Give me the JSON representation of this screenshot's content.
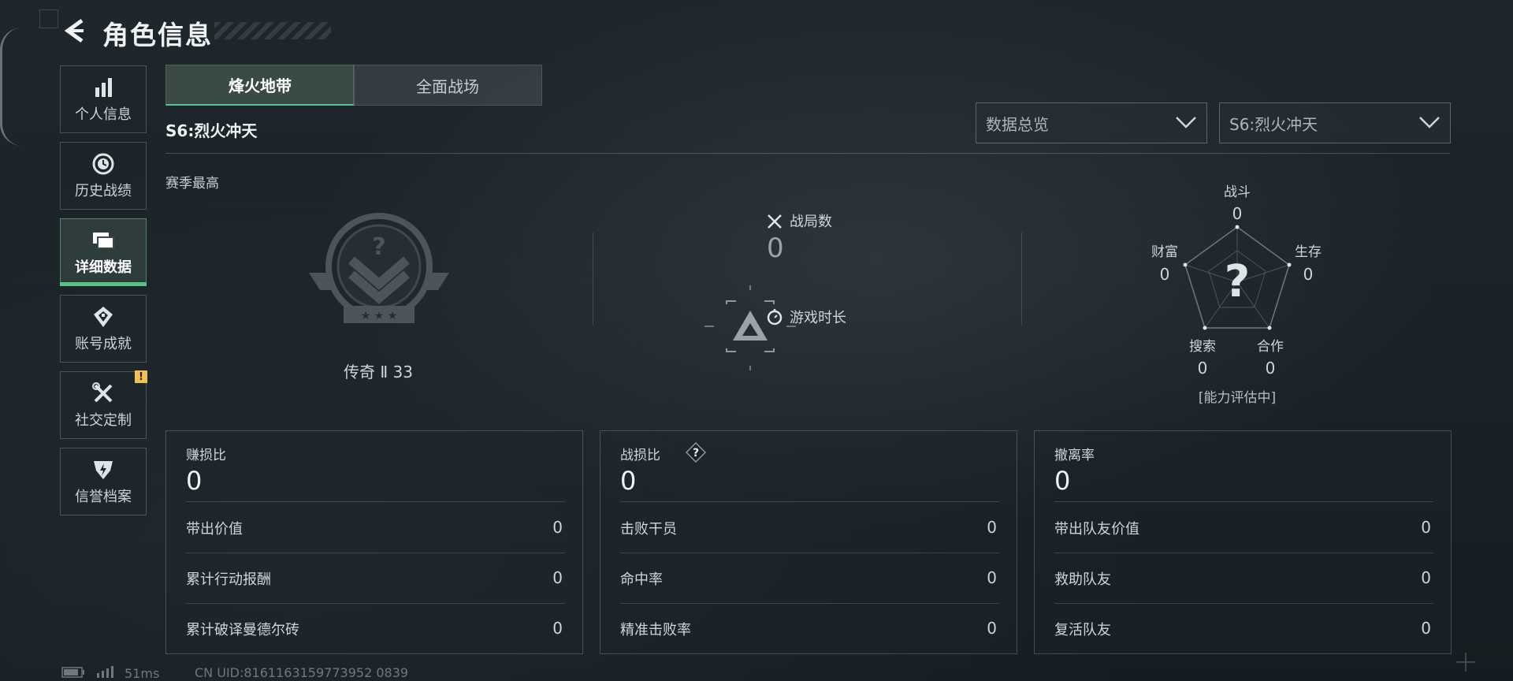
{
  "header": {
    "title": "角色信息"
  },
  "sidebar": {
    "items": [
      {
        "label": "个人信息",
        "icon": "bar-chart-icon"
      },
      {
        "label": "历史战绩",
        "icon": "clock-history-icon"
      },
      {
        "label": "详细数据",
        "icon": "folder-icon",
        "active": true
      },
      {
        "label": "账号成就",
        "icon": "achievement-icon"
      },
      {
        "label": "社交定制",
        "icon": "tools-icon",
        "badge": "!"
      },
      {
        "label": "信誉档案",
        "icon": "shield-bolt-icon"
      }
    ]
  },
  "tabs": [
    {
      "label": "烽火地带",
      "active": true
    },
    {
      "label": "全面战场",
      "active": false
    }
  ],
  "season_title": "S6:烈火冲天",
  "dropdowns": {
    "view": "数据总览",
    "season": "S6:烈火冲天"
  },
  "overview": {
    "season_best_label": "赛季最高",
    "rank_name": "传奇 Ⅱ 33",
    "battle_count_label": "战局数",
    "battle_count_value": "0",
    "play_time_label": "游戏时长"
  },
  "radar": {
    "axes": [
      {
        "label": "战斗",
        "value": "0"
      },
      {
        "label": "生存",
        "value": "0"
      },
      {
        "label": "合作",
        "value": "0"
      },
      {
        "label": "搜索",
        "value": "0"
      },
      {
        "label": "财富",
        "value": "0"
      }
    ],
    "status": "[能力评估中]"
  },
  "cards": [
    {
      "title": "赚损比",
      "value": "0",
      "rows": [
        {
          "label": "带出价值",
          "value": "0"
        },
        {
          "label": "累计行动报酬",
          "value": "0"
        },
        {
          "label": "累计破译曼德尔砖",
          "value": "0"
        }
      ]
    },
    {
      "title": "战损比",
      "value": "0",
      "help": "?",
      "rows": [
        {
          "label": "击败干员",
          "value": "0"
        },
        {
          "label": "命中率",
          "value": "0"
        },
        {
          "label": "精准击败率",
          "value": "0"
        }
      ]
    },
    {
      "title": "撤离率",
      "value": "0",
      "rows": [
        {
          "label": "带出队友价值",
          "value": "0"
        },
        {
          "label": "救助队友",
          "value": "0"
        },
        {
          "label": "复活队友",
          "value": "0"
        }
      ]
    }
  ],
  "footer": {
    "ping": "51ms",
    "uid": "CN UID:8161163159773952 0839"
  },
  "colors": {
    "accent": "#55c489",
    "warning": "#f2c14e"
  }
}
